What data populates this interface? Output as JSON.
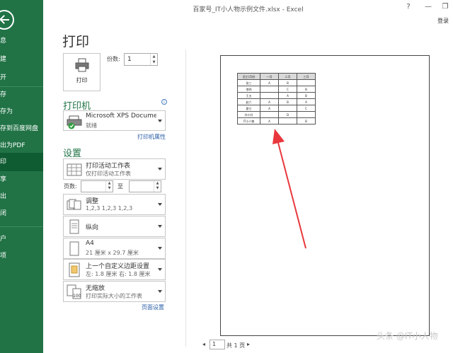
{
  "window": {
    "title": "百家号_IT小人物示例文件.xlsx - Excel",
    "help": "?",
    "minimize": "—",
    "restore": "❐",
    "signin": "登录"
  },
  "sidebar": {
    "items": [
      {
        "label": "息"
      },
      {
        "label": "建"
      },
      {
        "label": "开"
      },
      {
        "label": "存"
      },
      {
        "label": "存为"
      },
      {
        "label": "存到百度网盘"
      },
      {
        "label": "出为PDF"
      },
      {
        "label": "印",
        "active": true
      },
      {
        "label": "享"
      },
      {
        "label": "出"
      },
      {
        "label": "闭"
      },
      {
        "label": "户"
      },
      {
        "label": "项"
      }
    ]
  },
  "print": {
    "title": "打印",
    "button_label": "打印",
    "copies_label": "份数:",
    "copies_value": "1"
  },
  "printer": {
    "section": "打印机",
    "info": "i",
    "name": "Microsoft XPS Docume...",
    "status": "就绪",
    "properties_link": "打印机属性"
  },
  "settings": {
    "section": "设置",
    "what": {
      "main": "打印活动工作表",
      "sub": "仅打印活动工作表"
    },
    "pages_label": "页数:",
    "to_label": "至",
    "collate": {
      "main": "调整",
      "sub": "1,2,3    1,2,3    1,2,3"
    },
    "orientation": {
      "main": "纵向"
    },
    "paper": {
      "main": "A4",
      "sub": "21 厘米 x 29.7 厘米"
    },
    "margins": {
      "main": "上一个自定义边距设置",
      "sub": "左: 1.8 厘米    右: 1.8 厘米"
    },
    "scaling": {
      "main": "无缩放",
      "sub": "打印实际大小的工作表"
    },
    "page_setup_link": "页面设置"
  },
  "preview": {
    "headers": [
      "员工/月份",
      "一月",
      "二月",
      "三月"
    ],
    "rows": [
      [
        "张三",
        "A",
        "B",
        ""
      ],
      [
        "李四",
        "",
        "C",
        "B"
      ],
      [
        "王五",
        "",
        "A",
        "B"
      ],
      [
        "赵六",
        "A",
        "B",
        "A"
      ],
      [
        "夏七",
        "A",
        "",
        "C"
      ],
      [
        "孙小付",
        "",
        "D",
        ""
      ],
      [
        "IT小人物",
        "A",
        "",
        "B"
      ]
    ]
  },
  "pager": {
    "prev": "◂",
    "current": "1",
    "total": "共 1 页",
    "next": "▸"
  },
  "watermark": "头条 @IT小人物",
  "colors": {
    "brand": "#217346",
    "arrow": "#e8383d",
    "link": "#2a5ea8"
  }
}
